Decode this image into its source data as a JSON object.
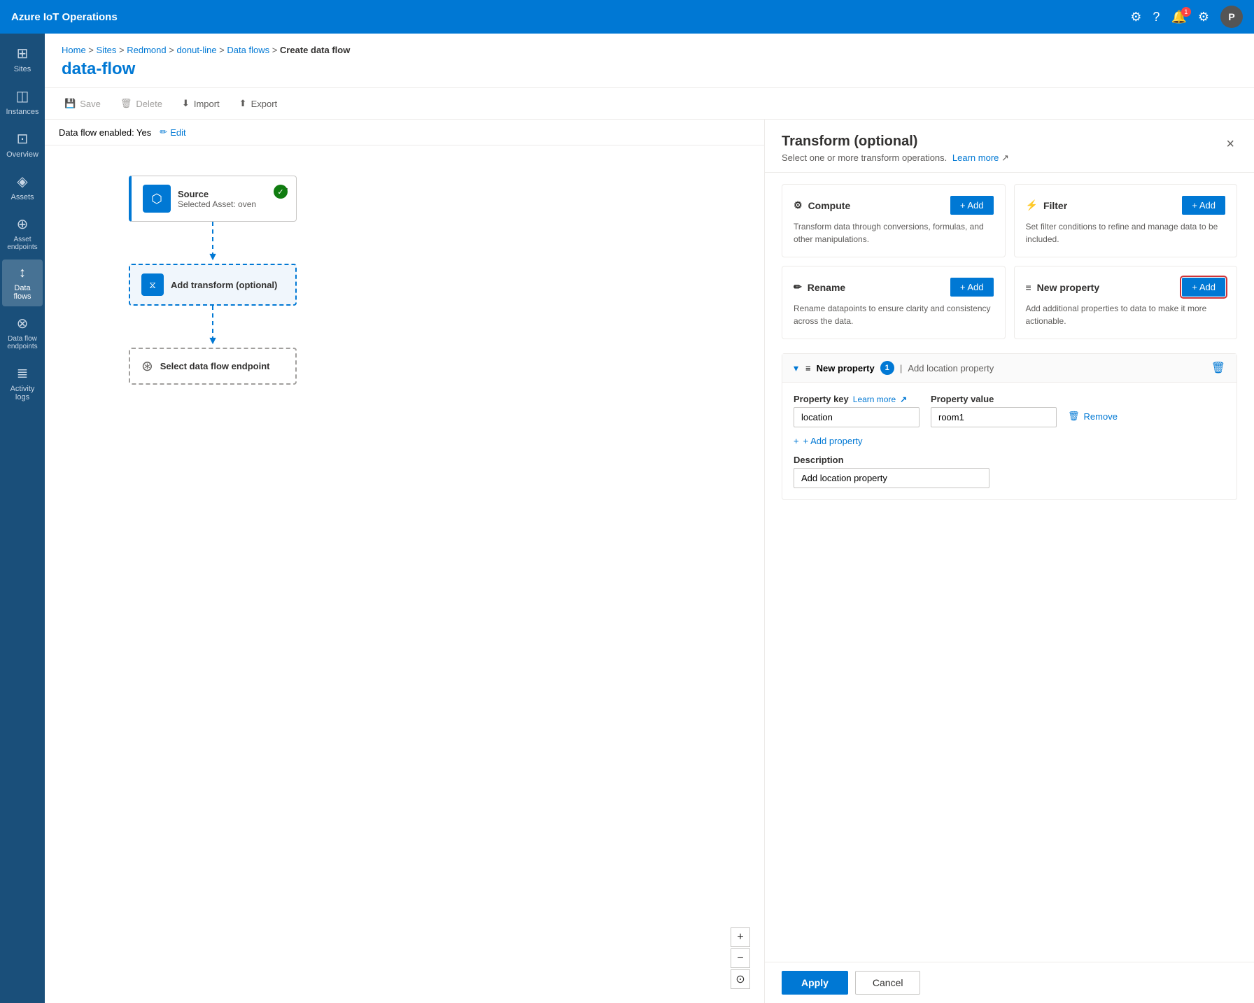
{
  "topbar": {
    "title": "Azure IoT Operations",
    "avatar": "P",
    "notification_count": "1"
  },
  "breadcrumb": {
    "items": [
      "Home",
      "Sites",
      "Redmond",
      "donut-line",
      "Data flows"
    ],
    "current": "Create data flow"
  },
  "page": {
    "title": "data-flow"
  },
  "toolbar": {
    "save": "Save",
    "delete": "Delete",
    "import": "Import",
    "export": "Export"
  },
  "enabled_bar": {
    "status": "Data flow enabled: Yes",
    "edit_label": "Edit"
  },
  "nodes": {
    "source": {
      "label": "Source",
      "sublabel": "Selected Asset: oven"
    },
    "transform": {
      "label": "Add transform (optional)"
    },
    "endpoint": {
      "label": "Select data flow endpoint"
    }
  },
  "panel": {
    "title": "Transform (optional)",
    "subtitle": "Select one or more transform operations.",
    "learn_more": "Learn more",
    "close_label": "×",
    "operations": [
      {
        "id": "compute",
        "icon": "⚙",
        "name": "Compute",
        "description": "Transform data through conversions, formulas, and other manipulations.",
        "add_label": "+ Add"
      },
      {
        "id": "filter",
        "icon": "⚡",
        "name": "Filter",
        "description": "Set filter conditions to refine and manage data to be included.",
        "add_label": "+ Add"
      },
      {
        "id": "rename",
        "icon": "✏",
        "name": "Rename",
        "description": "Rename datapoints to ensure clarity and consistency across the data.",
        "add_label": "+ Add"
      },
      {
        "id": "new_property",
        "icon": "≡",
        "name": "New property",
        "description": "Add additional properties to data to make it more actionable.",
        "add_label": "+ Add",
        "highlighted": true
      }
    ],
    "new_property_section": {
      "title": "New property",
      "badge": "1",
      "separator": "|",
      "header_description": "Add location property",
      "property_key_label": "Property key",
      "learn_more": "Learn more",
      "property_value_label": "Property value",
      "key_value": "location",
      "value_value": "room1",
      "remove_label": "Remove",
      "add_property_label": "+ Add property",
      "description_label": "Description",
      "description_value": "Add location property"
    },
    "footer": {
      "apply": "Apply",
      "cancel": "Cancel"
    }
  },
  "canvas": {
    "zoom_in": "+",
    "zoom_out": "−",
    "fit": "⊙"
  },
  "sidebar": {
    "items": [
      {
        "id": "sites",
        "label": "Sites",
        "icon": "⊞"
      },
      {
        "id": "instances",
        "label": "Instances",
        "icon": "◫"
      },
      {
        "id": "overview",
        "label": "Overview",
        "icon": "⊡"
      },
      {
        "id": "assets",
        "label": "Assets",
        "icon": "◈"
      },
      {
        "id": "asset-endpoints",
        "label": "Asset endpoints",
        "icon": "⊕"
      },
      {
        "id": "data-flows",
        "label": "Data flows",
        "icon": "↕",
        "active": true
      },
      {
        "id": "data-flow-endpoints",
        "label": "Data flow endpoints",
        "icon": "⊗"
      },
      {
        "id": "activity-logs",
        "label": "Activity logs",
        "icon": "≣"
      }
    ]
  }
}
